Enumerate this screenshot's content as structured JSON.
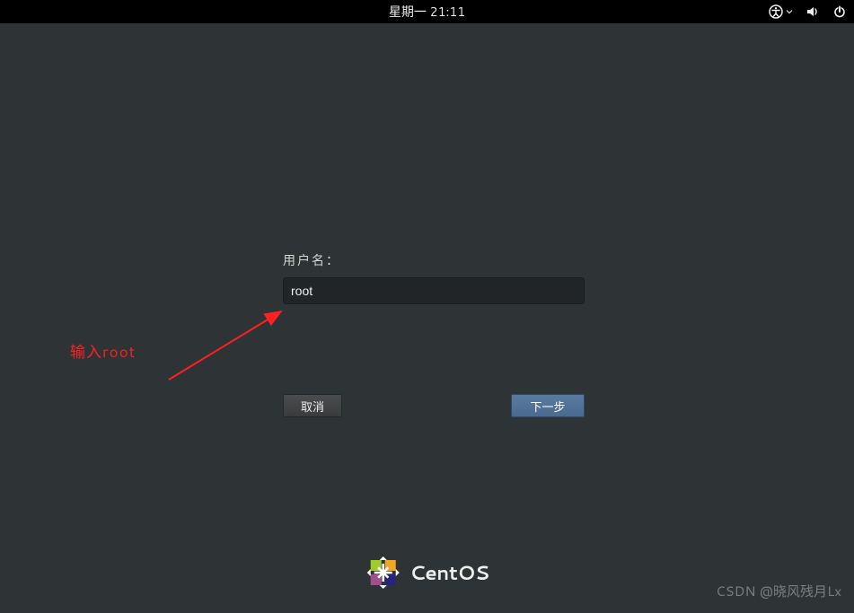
{
  "topbar": {
    "datetime": "星期一 21:11"
  },
  "login": {
    "username_label": "用户名：",
    "username_value": "root",
    "cancel_label": "取消",
    "next_label": "下一步"
  },
  "annotation": {
    "text": "输入root"
  },
  "branding": {
    "name": "CentOS"
  },
  "watermark": {
    "text": "CSDN @晓风残月Lx"
  }
}
